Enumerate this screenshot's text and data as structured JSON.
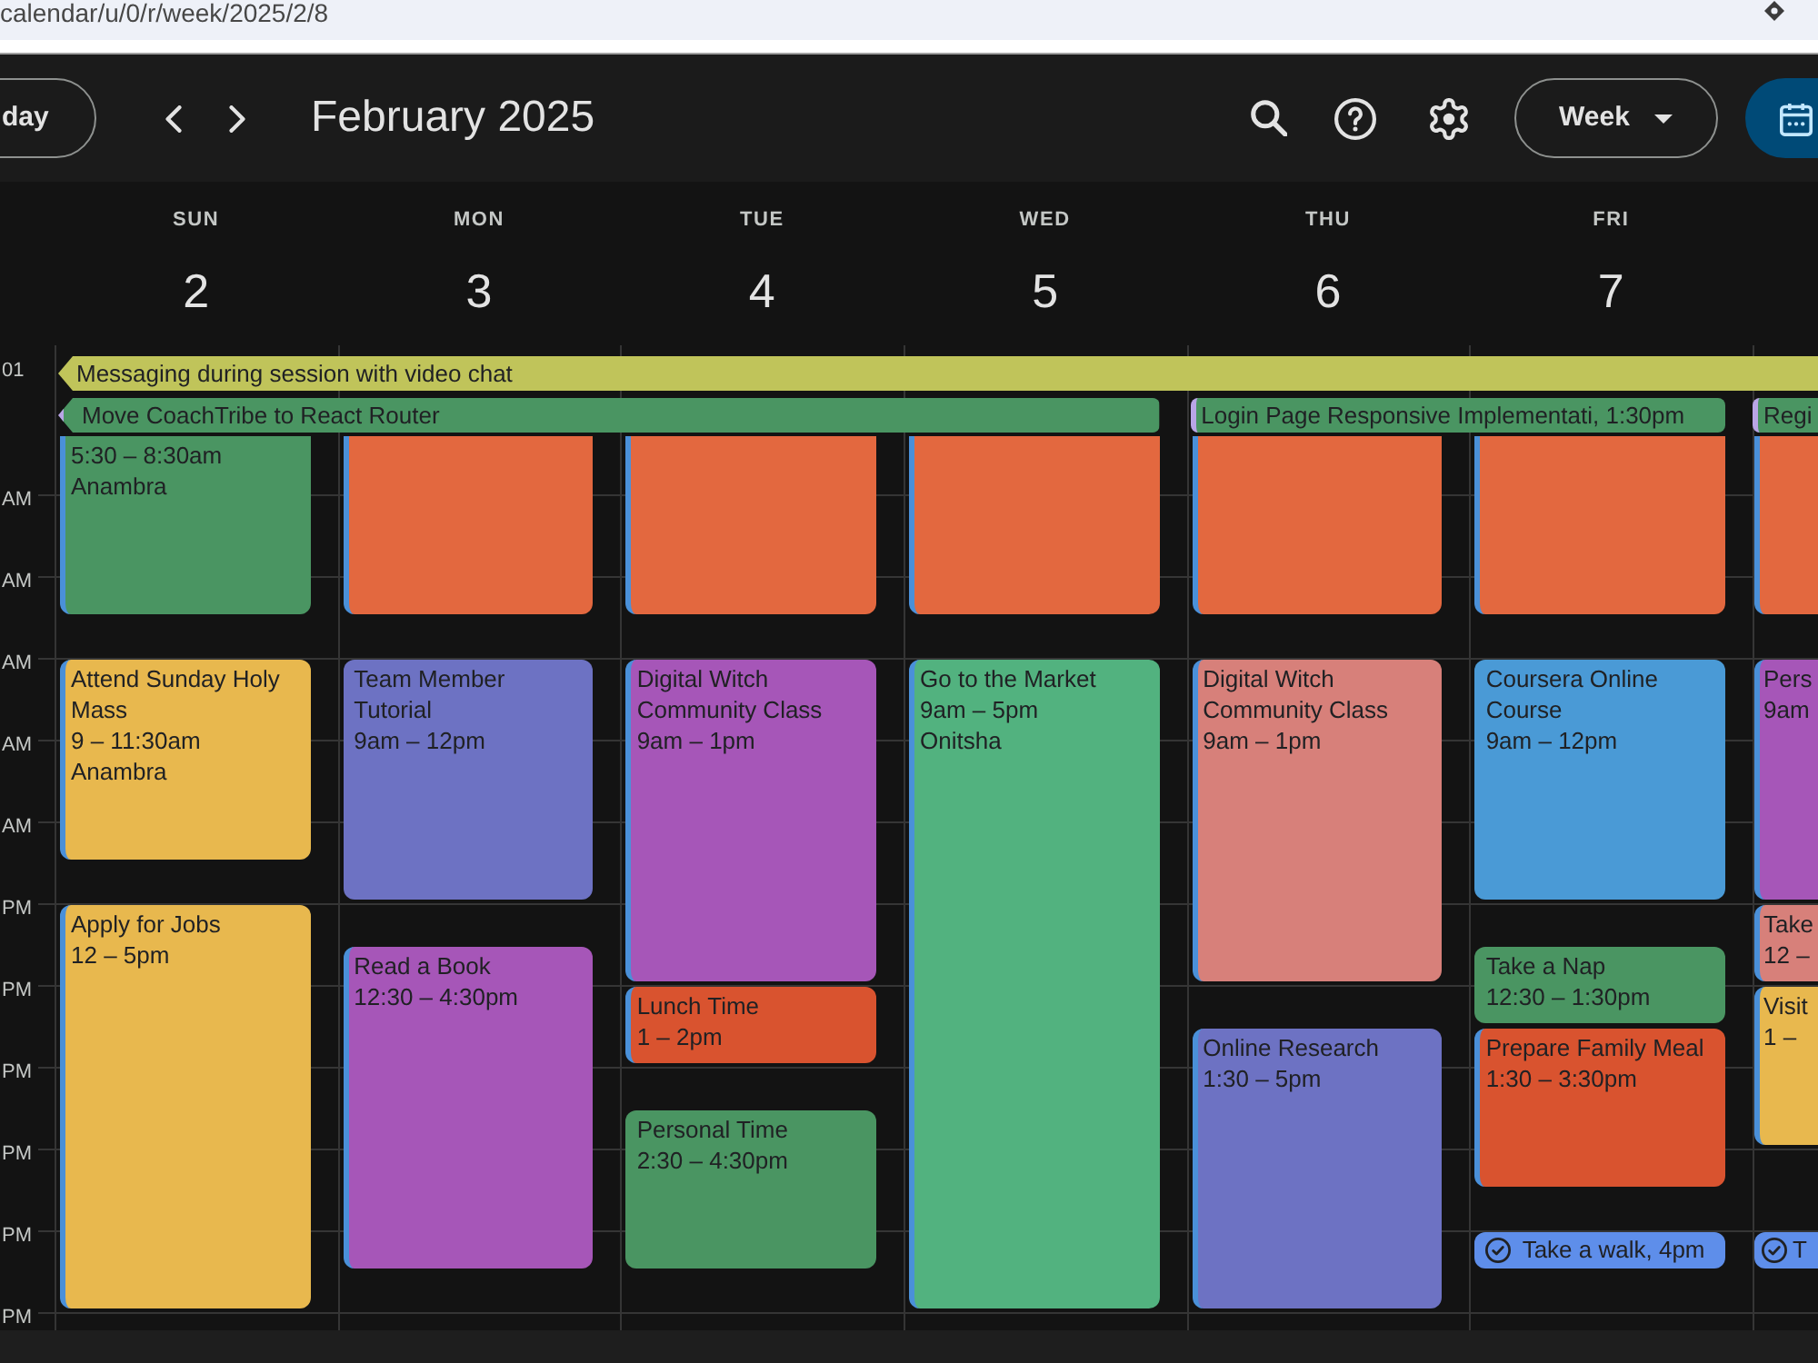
{
  "address_bar": {
    "url": "calendar/u/0/r/week/2025/2/8"
  },
  "toolbar": {
    "today_button": "day",
    "title": "February 2025",
    "view_menu": "Week"
  },
  "days": [
    {
      "weekday": "SUN",
      "date": "2"
    },
    {
      "weekday": "MON",
      "date": "3"
    },
    {
      "weekday": "TUE",
      "date": "4"
    },
    {
      "weekday": "WED",
      "date": "5"
    },
    {
      "weekday": "THU",
      "date": "6"
    },
    {
      "weekday": "FRI",
      "date": "7"
    }
  ],
  "all_day": {
    "timezone_label": "01",
    "rows": [
      [
        {
          "title": "Messaging during session with video chat",
          "color": "#c0c45a",
          "continues_before": true,
          "edge_marked": false
        }
      ],
      [
        {
          "title": "Move CoachTribe to React Router",
          "color": "#4a9562",
          "continues_before": true,
          "edge_marked": true
        },
        {
          "title": "Login Page Responsive Implementati, 1:30pm",
          "color": "#4a9562",
          "continues_before": false,
          "edge_marked": true
        },
        {
          "title": "Regi",
          "color": "#4a9562",
          "continues_before": false,
          "edge_marked": true
        }
      ]
    ]
  },
  "time_labels": [
    "AM",
    "AM",
    "AM",
    "AM",
    "AM",
    "PM",
    "PM",
    "PM",
    "PM",
    "PM",
    "PM"
  ],
  "event_columns": [
    [
      {
        "kind": "event",
        "time": "5:30 – 8:30am",
        "location": "Anambra",
        "color": "#4a9562",
        "edge_marked": true
      },
      {
        "kind": "event",
        "title": "Attend Sunday Holy Mass",
        "time": "9 – 11:30am",
        "location": "Anambra",
        "color": "#e8b84e",
        "edge_marked": true
      },
      {
        "kind": "event",
        "title": "Apply for Jobs",
        "time": "12 – 5pm",
        "color": "#e8b84e",
        "edge_marked": true
      }
    ],
    [
      {
        "kind": "event",
        "color": "#e3683f",
        "edge_marked": true
      },
      {
        "kind": "event",
        "title": "Team Member Tutorial",
        "time": "9am – 12pm",
        "color": "#6d72c3",
        "edge_marked": false
      },
      {
        "kind": "event",
        "title": "Read a Book",
        "time": "12:30 – 4:30pm",
        "color": "#a656b8",
        "edge_marked": true
      }
    ],
    [
      {
        "kind": "event",
        "color": "#e3683f",
        "edge_marked": true
      },
      {
        "kind": "event",
        "title": "Digital Witch Community Class",
        "time": "9am – 1pm",
        "color": "#a656b8",
        "edge_marked": true
      },
      {
        "kind": "event",
        "title": "Lunch Time",
        "time": "1 – 2pm",
        "color": "#d9532f",
        "edge_marked": true
      },
      {
        "kind": "event",
        "title": "Personal Time",
        "time": "2:30 – 4:30pm",
        "color": "#4a9562",
        "edge_marked": false
      }
    ],
    [
      {
        "kind": "event",
        "color": "#e3683f",
        "edge_marked": true
      },
      {
        "kind": "event",
        "title": "Go to the Market",
        "time": "9am – 5pm",
        "location": "Onitsha",
        "color": "#52b27f",
        "edge_marked": true
      }
    ],
    [
      {
        "kind": "event",
        "color": "#e3683f",
        "edge_marked": true
      },
      {
        "kind": "event",
        "title": "Digital Witch Community Class",
        "time": "9am – 1pm",
        "color": "#d7807a",
        "edge_marked": true
      },
      {
        "kind": "event",
        "title": "Online Research",
        "time": "1:30 – 5pm",
        "color": "#6d72c3",
        "edge_marked": true
      }
    ],
    [
      {
        "kind": "event",
        "color": "#e3683f",
        "edge_marked": true
      },
      {
        "kind": "event",
        "title": "Coursera Online Course",
        "time": "9am – 12pm",
        "color": "#4a9ad6",
        "edge_marked": false
      },
      {
        "kind": "event",
        "title": "Take a Nap",
        "time": "12:30 – 1:30pm",
        "color": "#4a9562",
        "edge_marked": false
      },
      {
        "kind": "event",
        "title": "Prepare Family Meal",
        "time": "1:30 – 3:30pm",
        "color": "#d9532f",
        "edge_marked": true
      },
      {
        "kind": "task",
        "title": "Take a walk, 4pm",
        "color": "#5e8eea"
      }
    ],
    [
      {
        "kind": "event",
        "color": "#e3683f",
        "edge_marked": true
      },
      {
        "kind": "event",
        "title": "Pers",
        "time": "9am",
        "color": "#a656b8",
        "edge_marked": true
      },
      {
        "kind": "event",
        "title": "Take",
        "time": "12 –",
        "color": "#d7807a",
        "edge_marked": true
      },
      {
        "kind": "event",
        "title": "Visit",
        "time": "1 –",
        "color": "#e8b84e",
        "edge_marked": true
      },
      {
        "kind": "task",
        "title": "T",
        "color": "#5e8eea"
      }
    ]
  ]
}
